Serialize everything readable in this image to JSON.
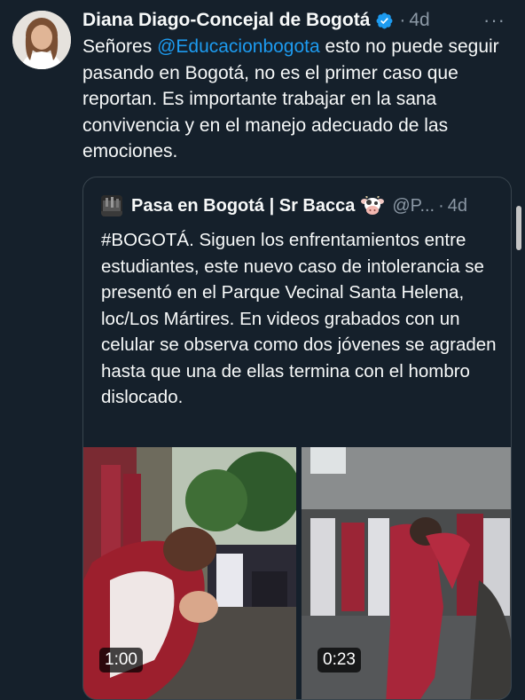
{
  "tweet": {
    "author_name": "Diana Diago-Concejal de Bogotá",
    "time": "4d",
    "dot": "·",
    "more": "···",
    "text_before": "Señores ",
    "mention": "@Educacionbogota",
    "text_after": " esto no puede seguir pasando en Bogotá, no es el primer caso que reportan. Es importante trabajar en la sana convivencia y en el manejo  adecuado de las emociones."
  },
  "quote": {
    "author_name": "Pasa en Bogotá | Sr Bacca",
    "handle": "@P...",
    "dot": "·",
    "time": "4d",
    "text": "#BOGOTÁ. Siguen los enfrentamientos entre estudiantes, este nuevo caso de intolerancia se presentó en el Parque Vecinal Santa Helena, loc/Los Mártires. En videos grabados con un celular se observa como dos jóvenes se agraden hasta que una de ellas termina con el hombro dislocado.",
    "videos": [
      {
        "duration": "1:00"
      },
      {
        "duration": "0:23"
      }
    ]
  },
  "colors": {
    "background": "#15202b",
    "text": "#f7f9f9",
    "secondary": "#8b98a5",
    "accent": "#1d9bf0",
    "border": "#38444d"
  },
  "icons": [
    "verified-badge-icon",
    "more-options-icon",
    "cow-emoji-icon"
  ]
}
